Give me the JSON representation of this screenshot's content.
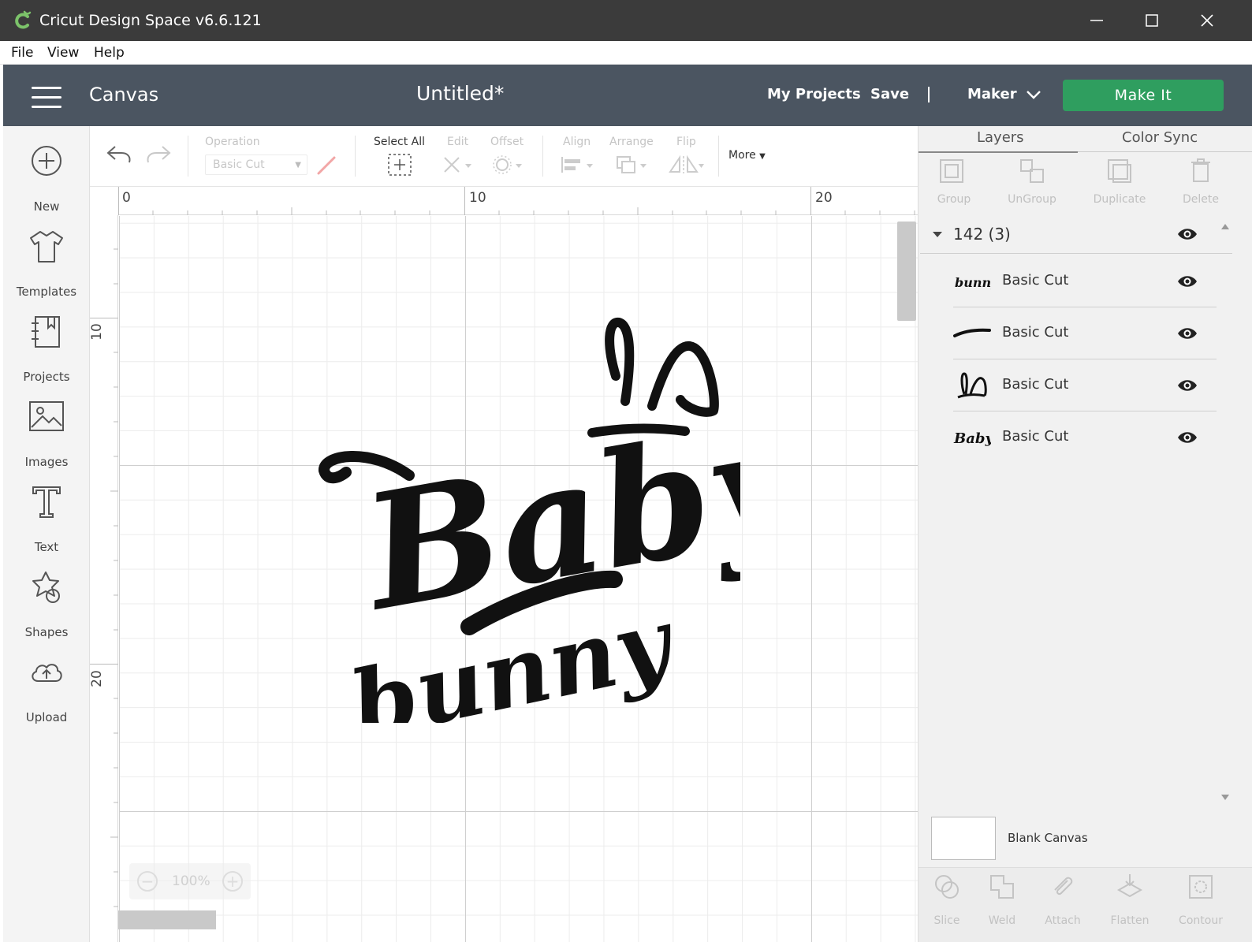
{
  "window": {
    "title": "Cricut Design Space  v6.6.121"
  },
  "menu": [
    "File",
    "View",
    "Help"
  ],
  "header": {
    "section": "Canvas",
    "project_title": "Untitled*",
    "my_projects": "My Projects",
    "save": "Save",
    "separator": "|",
    "machine": "Maker",
    "make_it": "Make It",
    "accent_color": "#2f9e5f",
    "bar_color": "#4b5561"
  },
  "sidebar": [
    {
      "label": "New",
      "icon": "plus-circle-icon"
    },
    {
      "label": "Templates",
      "icon": "tshirt-icon"
    },
    {
      "label": "Projects",
      "icon": "notebook-icon"
    },
    {
      "label": "Images",
      "icon": "image-icon"
    },
    {
      "label": "Text",
      "icon": "text-icon"
    },
    {
      "label": "Shapes",
      "icon": "shapes-icon"
    },
    {
      "label": "Upload",
      "icon": "cloud-upload-icon"
    }
  ],
  "toolbar": {
    "operation_label": "Operation",
    "operation_value": "Basic Cut",
    "select_all": "Select All",
    "edit": "Edit",
    "offset": "Offset",
    "align": "Align",
    "arrange": "Arrange",
    "flip": "Flip",
    "more": "More"
  },
  "canvas": {
    "ruler_top": [
      "0",
      "10",
      "20"
    ],
    "ruler_left": [
      "10",
      "20"
    ],
    "zoom": "100%",
    "design_text": [
      "Baby",
      "bunny"
    ]
  },
  "panel": {
    "tabs": [
      "Layers",
      "Color Sync"
    ],
    "actions": [
      "Group",
      "UnGroup",
      "Duplicate",
      "Delete"
    ],
    "group": "142 (3)",
    "layers": [
      {
        "name": "Basic Cut",
        "thumb": "bunny"
      },
      {
        "name": "Basic Cut",
        "thumb": ""
      },
      {
        "name": "Basic Cut",
        "thumb": ""
      },
      {
        "name": "Basic Cut",
        "thumb": "Baby"
      }
    ],
    "blank_canvas": "Blank Canvas",
    "bottom_actions": [
      "Slice",
      "Weld",
      "Attach",
      "Flatten",
      "Contour"
    ]
  }
}
